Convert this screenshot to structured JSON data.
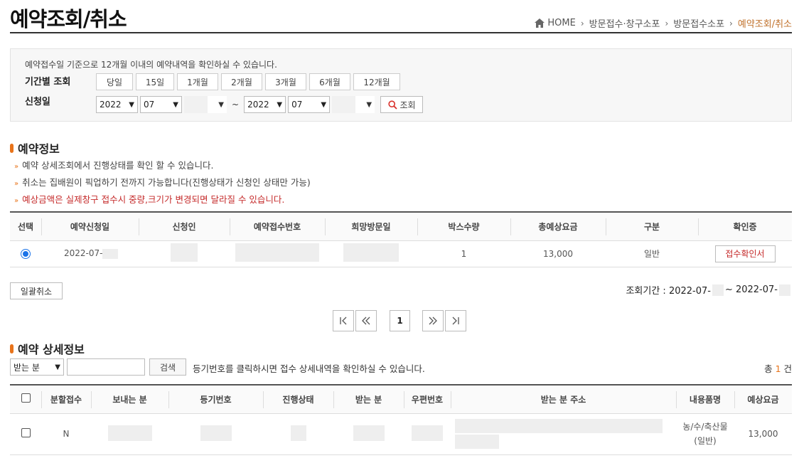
{
  "header": {
    "title": "예약조회/취소",
    "breadcrumb": [
      "HOME",
      "방문접수·창구소포",
      "방문접수소포",
      "예약조회/취소"
    ]
  },
  "search": {
    "notice": "예약접수일 기준으로 12개월 이내의 예약내역을 확인하실 수 있습니다.",
    "period_label": "기간별 조회",
    "date_label": "신청일",
    "periods": [
      "당일",
      "15일",
      "1개월",
      "2개월",
      "3개월",
      "6개월",
      "12개월"
    ],
    "from_year": "2022",
    "from_month": "07",
    "to_year": "2022",
    "to_month": "07",
    "tilde": "~",
    "query_label": "조회"
  },
  "reservation": {
    "section_title": "예약정보",
    "info": [
      "예약 상세조회에서 진행상태를 확인 할 수 있습니다.",
      "취소는 집배원이 픽업하기 전까지 가능합니다(진행상태가 신청인 상태만 가능)",
      "예상금액은 실제창구 접수시 중량,크기가 변경되면 달라질 수 있습니다."
    ],
    "columns": [
      "선택",
      "예약신청일",
      "신청인",
      "예약접수번호",
      "희망방문일",
      "박스수량",
      "총예상요금",
      "구분",
      "확인증"
    ],
    "row": {
      "date": "2022-07-",
      "box_count": "1",
      "fee": "13,000",
      "type": "일반",
      "confirm_label": "접수확인서"
    },
    "bulk_cancel_label": "일괄취소",
    "period_prefix": "조회기간 : 2022-07-",
    "period_mid": " ~ 2022-07-"
  },
  "pagination": {
    "first": "first",
    "prev": "prev",
    "current": "1",
    "next": "next",
    "last": "last"
  },
  "detail": {
    "section_title": "예약 상세정보",
    "search_select": "받는 분",
    "search_button": "검색",
    "hint": "등기번호를 클릭하시면 접수 상세내역을 확인하실 수 있습니다.",
    "total_prefix": "총 ",
    "total_count": "1",
    "total_suffix": " 건",
    "columns": [
      "분할접수",
      "보내는 분",
      "등기번호",
      "진행상태",
      "받는 분",
      "우편번호",
      "받는 분 주소",
      "내용품명",
      "예상요금"
    ],
    "row": {
      "split": "N",
      "item_name": "농/수/축산물",
      "item_type": "(일반)",
      "fee": "13,000"
    }
  },
  "colors": {
    "accent": "#e8731a",
    "warn": "#c52b2b",
    "breadcrumb_current": "#c0712b"
  }
}
